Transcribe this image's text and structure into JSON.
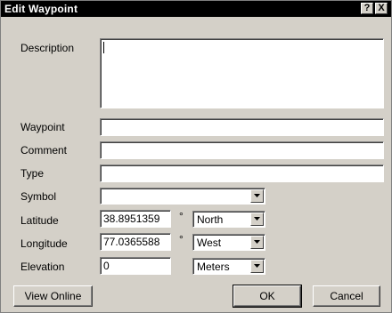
{
  "window": {
    "title": "Edit Waypoint",
    "help_label": "?",
    "close_label": "X"
  },
  "labels": {
    "description": "Description",
    "waypoint": "Waypoint",
    "comment": "Comment",
    "type": "Type",
    "symbol": "Symbol",
    "latitude": "Latitude",
    "longitude": "Longitude",
    "elevation": "Elevation"
  },
  "fields": {
    "description": "",
    "waypoint": "",
    "comment": "",
    "type": "",
    "symbol": "",
    "latitude": "38.8951359",
    "longitude": "77.0365588",
    "elevation": "0"
  },
  "units": {
    "degree_symbol": "°",
    "latitude_direction": "North",
    "longitude_direction": "West",
    "elevation_unit": "Meters"
  },
  "buttons": {
    "view_online": "View Online",
    "ok": "OK",
    "cancel": "Cancel"
  }
}
